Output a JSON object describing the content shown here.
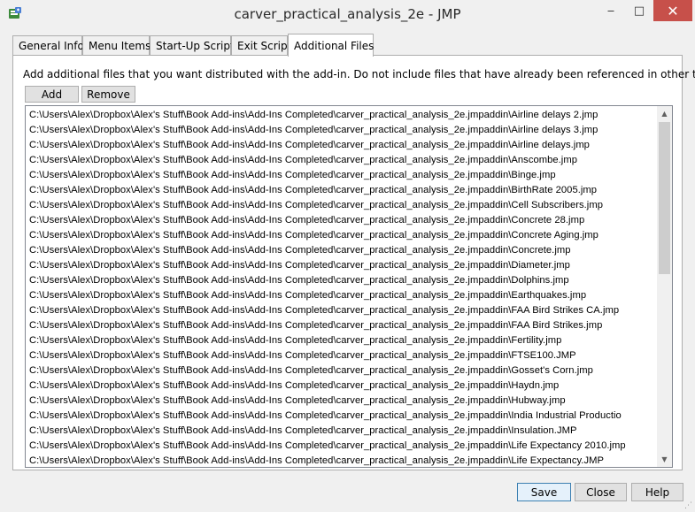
{
  "window": {
    "title": "carver_practical_analysis_2e - JMP",
    "minimize": "‒",
    "maximize": "□",
    "close": "✕"
  },
  "tabs": [
    {
      "label": "General Info"
    },
    {
      "label": "Menu Items"
    },
    {
      "label": "Start-Up Script"
    },
    {
      "label": "Exit Script"
    },
    {
      "label": "Additional Files",
      "active": true
    }
  ],
  "panel": {
    "instruction": "Add additional files that you want distributed with the add-in. Do not include files that have already been referenced in other tabs.",
    "add_label": "Add",
    "remove_label": "Remove",
    "files": [
      "C:\\Users\\Alex\\Dropbox\\Alex's Stuff\\Book Add-ins\\Add-Ins Completed\\carver_practical_analysis_2e.jmpaddin\\Airline delays 2.jmp",
      "C:\\Users\\Alex\\Dropbox\\Alex's Stuff\\Book Add-ins\\Add-Ins Completed\\carver_practical_analysis_2e.jmpaddin\\Airline delays 3.jmp",
      "C:\\Users\\Alex\\Dropbox\\Alex's Stuff\\Book Add-ins\\Add-Ins Completed\\carver_practical_analysis_2e.jmpaddin\\Airline delays.jmp",
      "C:\\Users\\Alex\\Dropbox\\Alex's Stuff\\Book Add-ins\\Add-Ins Completed\\carver_practical_analysis_2e.jmpaddin\\Anscombe.jmp",
      "C:\\Users\\Alex\\Dropbox\\Alex's Stuff\\Book Add-ins\\Add-Ins Completed\\carver_practical_analysis_2e.jmpaddin\\Binge.jmp",
      "C:\\Users\\Alex\\Dropbox\\Alex's Stuff\\Book Add-ins\\Add-Ins Completed\\carver_practical_analysis_2e.jmpaddin\\BirthRate 2005.jmp",
      "C:\\Users\\Alex\\Dropbox\\Alex's Stuff\\Book Add-ins\\Add-Ins Completed\\carver_practical_analysis_2e.jmpaddin\\Cell Subscribers.jmp",
      "C:\\Users\\Alex\\Dropbox\\Alex's Stuff\\Book Add-ins\\Add-Ins Completed\\carver_practical_analysis_2e.jmpaddin\\Concrete 28.jmp",
      "C:\\Users\\Alex\\Dropbox\\Alex's Stuff\\Book Add-ins\\Add-Ins Completed\\carver_practical_analysis_2e.jmpaddin\\Concrete Aging.jmp",
      "C:\\Users\\Alex\\Dropbox\\Alex's Stuff\\Book Add-ins\\Add-Ins Completed\\carver_practical_analysis_2e.jmpaddin\\Concrete.jmp",
      "C:\\Users\\Alex\\Dropbox\\Alex's Stuff\\Book Add-ins\\Add-Ins Completed\\carver_practical_analysis_2e.jmpaddin\\Diameter.jmp",
      "C:\\Users\\Alex\\Dropbox\\Alex's Stuff\\Book Add-ins\\Add-Ins Completed\\carver_practical_analysis_2e.jmpaddin\\Dolphins.jmp",
      "C:\\Users\\Alex\\Dropbox\\Alex's Stuff\\Book Add-ins\\Add-Ins Completed\\carver_practical_analysis_2e.jmpaddin\\Earthquakes.jmp",
      "C:\\Users\\Alex\\Dropbox\\Alex's Stuff\\Book Add-ins\\Add-Ins Completed\\carver_practical_analysis_2e.jmpaddin\\FAA Bird Strikes CA.jmp",
      "C:\\Users\\Alex\\Dropbox\\Alex's Stuff\\Book Add-ins\\Add-Ins Completed\\carver_practical_analysis_2e.jmpaddin\\FAA Bird Strikes.jmp",
      "C:\\Users\\Alex\\Dropbox\\Alex's Stuff\\Book Add-ins\\Add-Ins Completed\\carver_practical_analysis_2e.jmpaddin\\Fertility.jmp",
      "C:\\Users\\Alex\\Dropbox\\Alex's Stuff\\Book Add-ins\\Add-Ins Completed\\carver_practical_analysis_2e.jmpaddin\\FTSE100.JMP",
      "C:\\Users\\Alex\\Dropbox\\Alex's Stuff\\Book Add-ins\\Add-Ins Completed\\carver_practical_analysis_2e.jmpaddin\\Gosset's Corn.jmp",
      "C:\\Users\\Alex\\Dropbox\\Alex's Stuff\\Book Add-ins\\Add-Ins Completed\\carver_practical_analysis_2e.jmpaddin\\Haydn.jmp",
      "C:\\Users\\Alex\\Dropbox\\Alex's Stuff\\Book Add-ins\\Add-Ins Completed\\carver_practical_analysis_2e.jmpaddin\\Hubway.jmp",
      "C:\\Users\\Alex\\Dropbox\\Alex's Stuff\\Book Add-ins\\Add-Ins Completed\\carver_practical_analysis_2e.jmpaddin\\India Industrial Productio",
      "C:\\Users\\Alex\\Dropbox\\Alex's Stuff\\Book Add-ins\\Add-Ins Completed\\carver_practical_analysis_2e.jmpaddin\\Insulation.JMP",
      "C:\\Users\\Alex\\Dropbox\\Alex's Stuff\\Book Add-ins\\Add-Ins Completed\\carver_practical_analysis_2e.jmpaddin\\Life Expectancy 2010.jmp",
      "C:\\Users\\Alex\\Dropbox\\Alex's Stuff\\Book Add-ins\\Add-Ins Completed\\carver_practical_analysis_2e.jmpaddin\\Life Expectancy.JMP"
    ]
  },
  "footer": {
    "save_label": "Save",
    "close_label": "Close",
    "help_label": "Help"
  },
  "colors": {
    "close_button_bg": "#c7504a",
    "window_bg": "#f0f0f0",
    "default_button_border": "#3c7fb1"
  }
}
